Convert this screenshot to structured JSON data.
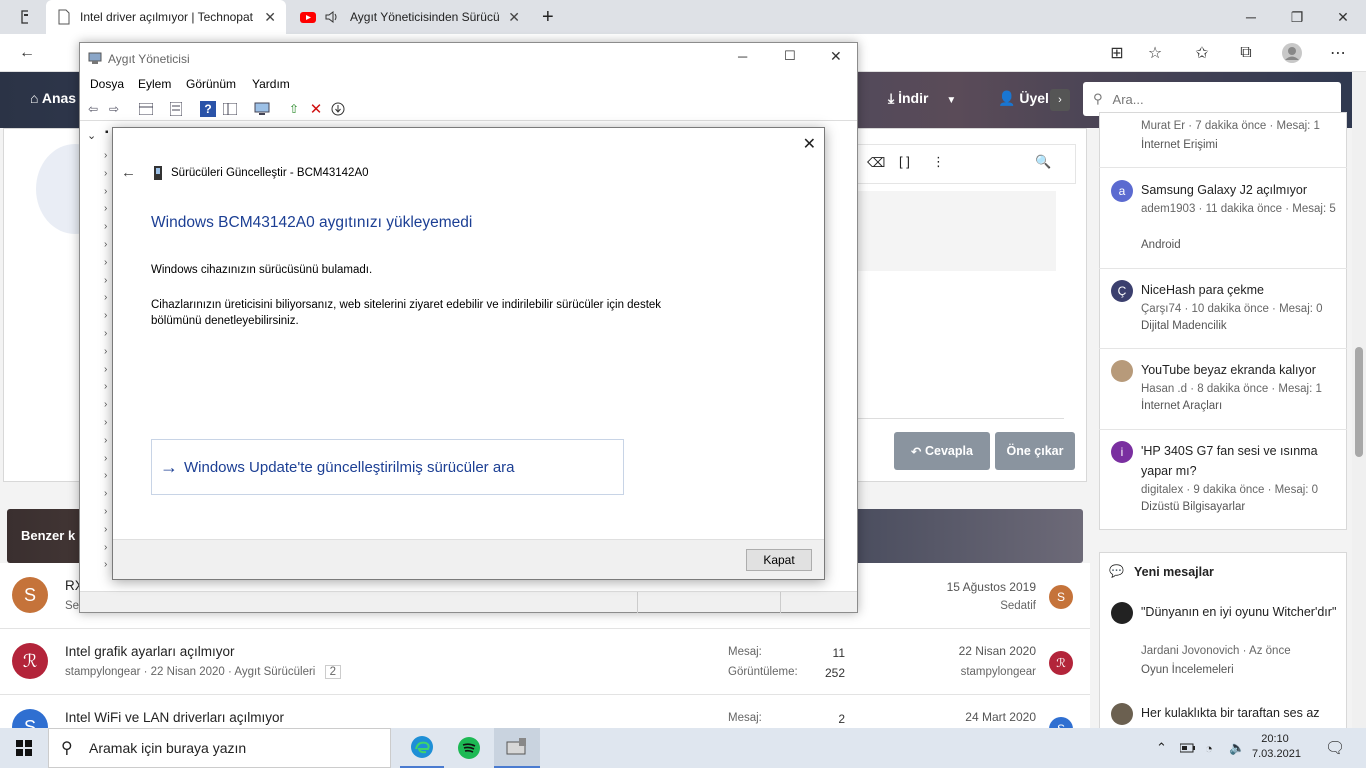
{
  "browser": {
    "tabs": [
      {
        "title": "Intel driver açılmıyor | Technopat",
        "close": "✕"
      },
      {
        "title": "Aygıt Yöneticisinden Sürücü",
        "close": "✕"
      }
    ],
    "new_tab": "+"
  },
  "site": {
    "nav_left": "Anas",
    "nav_download": "İndir",
    "nav_members": "Üyel",
    "search_placeholder": "Ara...",
    "reply_button": "Cevapla",
    "feature_button": "Öne çıkar",
    "similar_header": "Benzer k",
    "sidebar_top": {
      "meta": "Murat Er · 7 dakika önce · Mesaj: 1",
      "category": "İnternet Erişimi"
    },
    "sidebar_items": [
      {
        "avatar": "a",
        "title": "Samsung Galaxy J2 açılmıyor",
        "meta": "adem1903 · 11 dakika önce · Mesaj: 5",
        "category": "Android",
        "color": "#5b6ad0"
      },
      {
        "avatar": "Ç",
        "title": "NiceHash para çekme",
        "meta": "Çarşı74 · 10 dakika önce · Mesaj: 0",
        "category": "Dijital Madencilik",
        "color": "#3b3f6e"
      },
      {
        "avatar": "",
        "title": "YouTube beyaz ekranda kalıyor",
        "meta": "Hasan .d · 8 dakika önce · Mesaj: 1",
        "category": "İnternet Araçları",
        "color": "#b79a7a"
      },
      {
        "avatar": "i",
        "title": "'HP 340S G7 fan sesi ve ısınma yapar mı?",
        "meta": "digitalex · 9 dakika önce · Mesaj: 0",
        "category": "Dizüstü Bilgisayarlar",
        "color": "#7a2fa0"
      }
    ],
    "new_messages_title": "Yeni mesajlar",
    "new_messages": [
      {
        "title": "\"Dünyanın en iyi oyunu Witcher'dır\"",
        "meta": "Jardani Jovonovich · Az önce",
        "category": "Oyun İncelemeleri"
      },
      {
        "title": "Her kulaklıkta bir taraftan ses az",
        "meta": "",
        "category": ""
      }
    ],
    "list_rows": [
      {
        "avatar": "S",
        "title": "RX",
        "sub": "Se",
        "date": "15 Ağustos 2019",
        "user": "Sedatif",
        "color": "#c5733a",
        "msg_label": "",
        "msg": "",
        "view_label": "",
        "views": ""
      },
      {
        "avatar": "",
        "title": "Intel grafik ayarları açılmıyor",
        "sub": "stampylongear · 22 Nisan 2020 · Aygıt Sürücüleri",
        "page_badge": "2",
        "date": "22 Nisan 2020",
        "user": "stampylongear",
        "color": "#b3243a",
        "msg_label": "Mesaj:",
        "msg": "11",
        "view_label": "Görüntüleme:",
        "views": "252"
      },
      {
        "avatar": "S",
        "title": "Intel WiFi ve LAN driverları açılmıyor",
        "sub": "",
        "date": "24 Mart 2020",
        "user": "",
        "color": "#2f6fd1",
        "msg_label": "Mesaj:",
        "msg": "2",
        "view_label": "",
        "views": ""
      }
    ]
  },
  "device_manager": {
    "title": "Aygıt Yöneticisi",
    "menu": [
      "Dosya",
      "Eylem",
      "Görünüm",
      "Yardım"
    ]
  },
  "dialog": {
    "crumb": "Sürücüleri Güncelleştir - BCM43142A0",
    "heading": "Windows BCM43142A0 aygıtınızı yükleyemedi",
    "line1": "Windows cihazınızın sürücüsünü bulamadı.",
    "line2": "Cihazlarınızın üreticisini biliyorsanız, web sitelerini ziyaret edebilir ve indirilebilir sürücüler için destek bölümünü denetleyebilirsiniz.",
    "link": "Windows Update'te güncelleştirilmiş sürücüler ara",
    "close_button": "Kapat"
  },
  "taskbar": {
    "search_placeholder": "Aramak için buraya yazın",
    "time": "20:10",
    "date": "7.03.2021"
  },
  "colors": {
    "accent": "#1c3f94",
    "button_grey": "#8a949f"
  }
}
